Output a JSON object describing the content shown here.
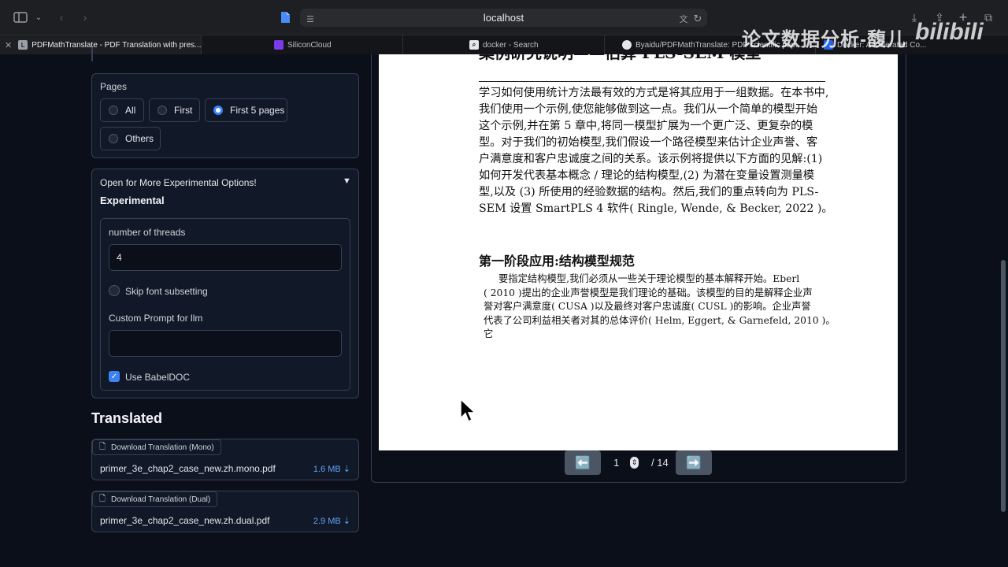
{
  "browser": {
    "url": "localhost",
    "tabs": [
      {
        "label": "PDFMathTranslate - PDF Translation with pres..."
      },
      {
        "label": "SiliconCloud"
      },
      {
        "label": "docker - Search"
      },
      {
        "label": "Byaidu/PDFMathTranslate: PDF scientific pap..."
      },
      {
        "label": "Docker: Accelerated Co..."
      }
    ],
    "favicon_letter": "L"
  },
  "watermark": {
    "text": "论文数据分析-馥儿",
    "brand": "bilibili"
  },
  "pages": {
    "label": "Pages",
    "options": [
      {
        "label": "All",
        "selected": false
      },
      {
        "label": "First",
        "selected": false
      },
      {
        "label": "First 5 pages",
        "selected": true
      },
      {
        "label": "Others",
        "selected": false
      }
    ]
  },
  "experimental": {
    "accordion_label": "Open for More Experimental Options!",
    "accordion_icon": "▼",
    "heading": "Experimental",
    "threads_label": "number of threads",
    "threads_value": "4",
    "skip_font_label": "Skip font subsetting",
    "skip_font_checked": false,
    "prompt_label": "Custom Prompt for llm",
    "prompt_value": "",
    "babeldoc_label": "Use BabelDOC",
    "babeldoc_checked": true
  },
  "translated": {
    "heading": "Translated",
    "mono": {
      "header": "Download Translation (Mono)",
      "file": "primer_3e_chap2_case_new.zh.mono.pdf",
      "size": "1.6 MB"
    },
    "dual": {
      "header": "Download Translation (Dual)",
      "file": "primer_3e_chap2_case_new.zh.dual.pdf",
      "size": "2.9 MB"
    }
  },
  "pdf": {
    "top_cut": "案例研究说明——估算 PLS-SEM 模型",
    "paragraph1": [
      "学习如何使用统计方法最有效的方式是将其应用于一组数据。在本书中,",
      "我们使用一个示例,使您能够做到这一点。我们从一个简单的模型开始",
      "这个示例,并在第 5 章中,将同一模型扩展为一个更广泛、更复杂的模",
      "型。对于我们的初始模型,我们假设一个路径模型来估计企业声誉、客",
      "户满意度和客户忠诚度之间的关系。该示例将提供以下方面的见解:(1)",
      "如何开发代表基本概念 / 理论的结构模型,(2) 为潜在变量设置测量模",
      "型,以及 (3) 所使用的经验数据的结构。然后,我们的重点转向为 PLS-",
      "SEM 设置 SmartPLS 4 软件( Ringle, Wende, & Becker, 2022 )。"
    ],
    "section_title": "第一阶段应用:结构模型规范",
    "paragraph2": [
      "要指定结构模型,我们必须从一些关于理论模型的基本解释开始。Eberl",
      "( 2010 )提出的企业声誉模型是我们理论的基础。该模型的目的是解释企业声",
      "誉对客户满意度( CUSA )以及最终对客户忠诚度( CUSL )的影响。企业声誉",
      "代表了公司利益相关者对其的总体评价( Helm, Eggert, & Garnefeld, 2010 )。",
      "它"
    ],
    "current_page": "1",
    "total_pages": "/ 14",
    "prev_icon": "⬅️",
    "next_icon": "➡️"
  }
}
